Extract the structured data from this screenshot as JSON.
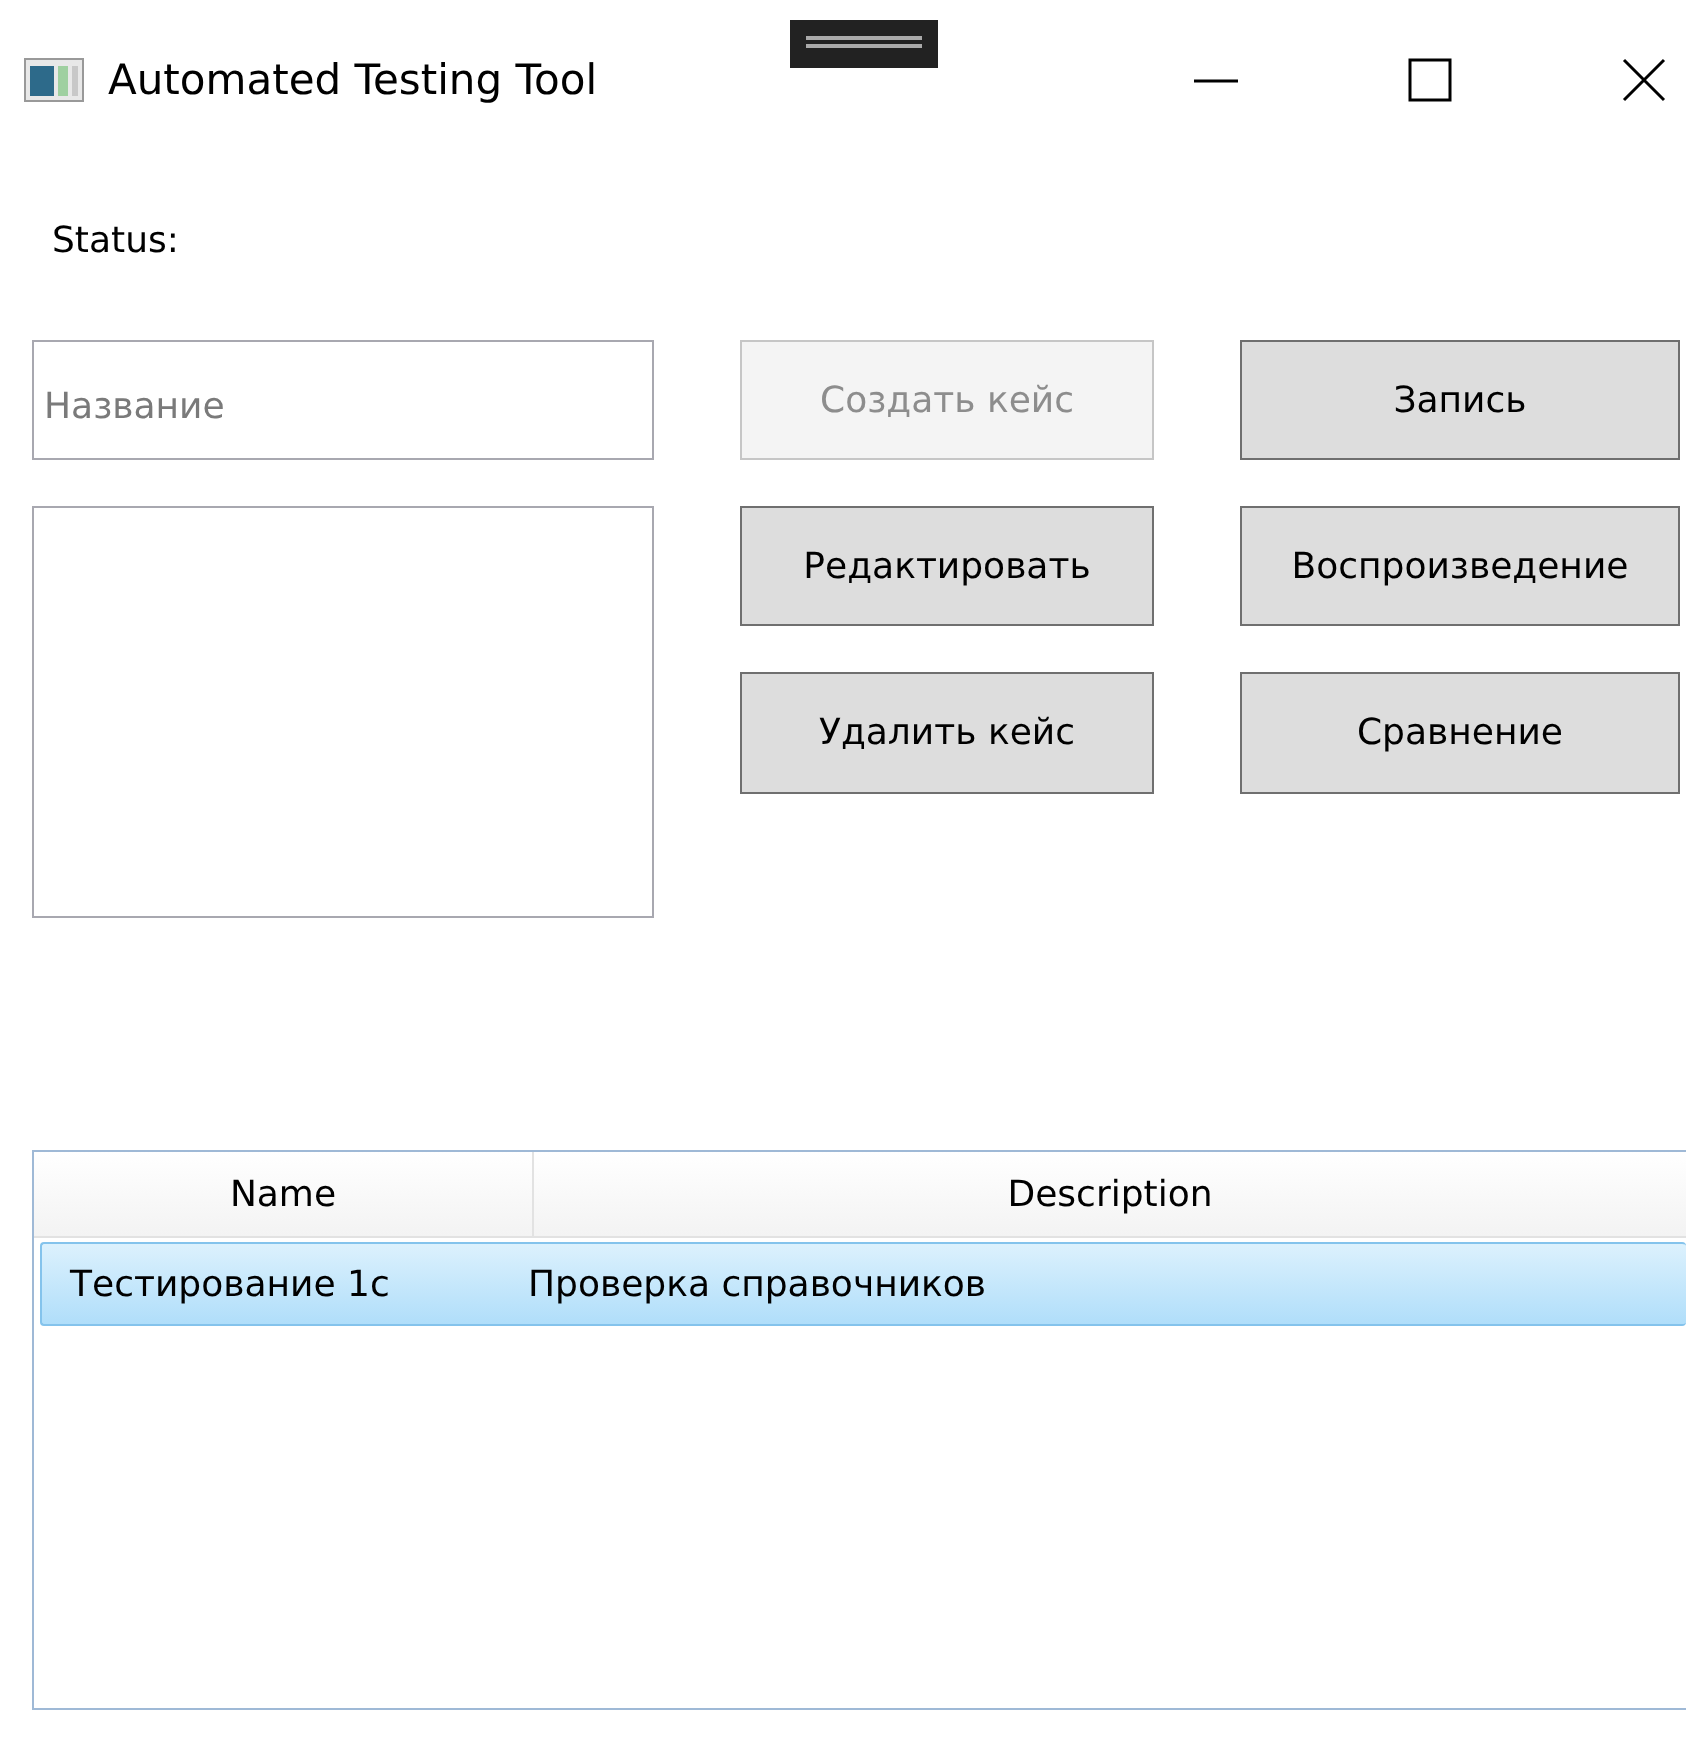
{
  "window": {
    "title": "Automated Testing Tool"
  },
  "status": {
    "label": "Status:"
  },
  "name_field": {
    "placeholder": "Название"
  },
  "buttons": [
    {
      "label": "Создать кейс",
      "disabled": true
    },
    {
      "label": "Запись",
      "disabled": false
    },
    {
      "label": "Редактировать",
      "disabled": false
    },
    {
      "label": "Воспроизведение",
      "disabled": false
    },
    {
      "label": "Удалить кейс",
      "disabled": false
    },
    {
      "label": "Сравнение",
      "disabled": false
    }
  ],
  "table": {
    "columns": [
      {
        "label": "Name"
      },
      {
        "label": "Description"
      }
    ],
    "rows": [
      {
        "cells": [
          "Тестирование 1с",
          "Проверка справочников"
        ],
        "selected": true
      }
    ]
  }
}
